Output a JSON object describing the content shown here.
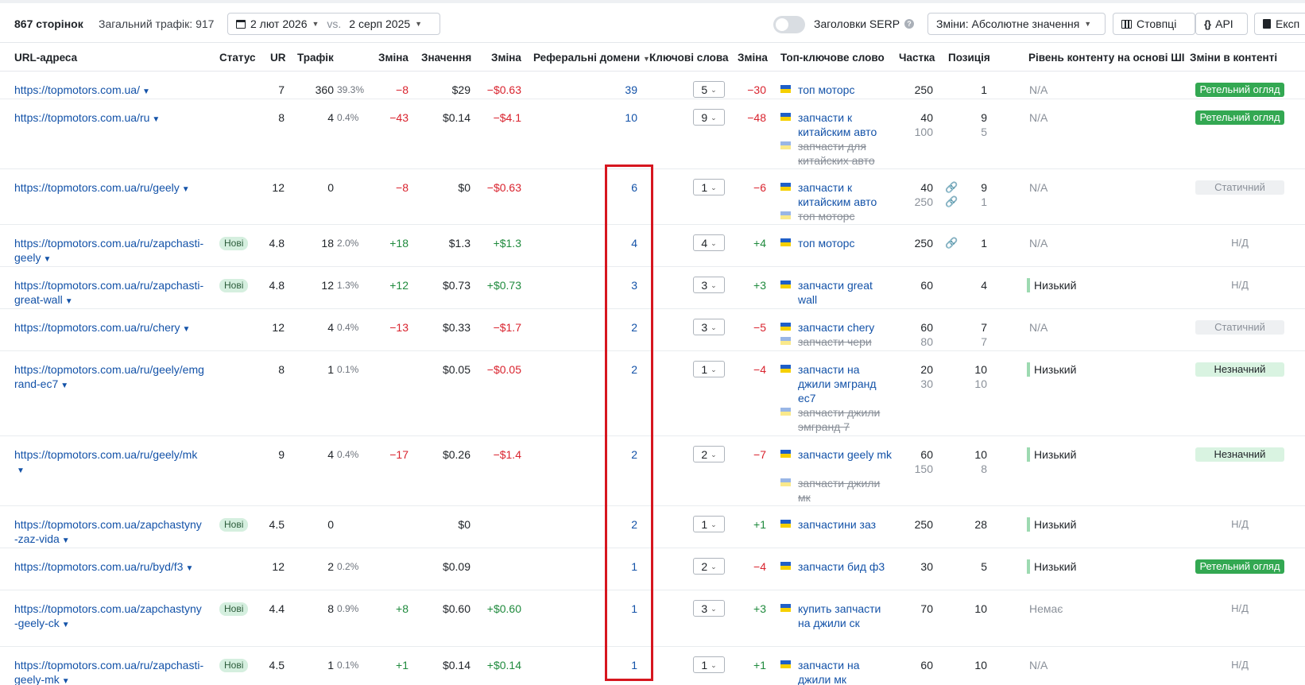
{
  "toolbar": {
    "pages_count": "867 сторінок",
    "total_traffic": "Загальний трафік: 917",
    "date_current": "2 лют 2026",
    "vs": "vs.",
    "date_compare": "2 серп 2025",
    "serp_titles": "Заголовки SERP",
    "changes_mode": "Зміни: Абсолютне значення",
    "columns": "Стовпці",
    "api": "API",
    "export": "Експ"
  },
  "columns": {
    "url": "URL-адреса",
    "status": "Статус",
    "ur": "UR",
    "traffic": "Трафік",
    "traffic_change": "Зміна",
    "value": "Значення",
    "value_change": "Зміна",
    "ref_domains": "Реферальні домени",
    "keywords": "Ключові слова",
    "kw_change": "Зміна",
    "top_keyword": "Топ-ключове слово",
    "share": "Частка",
    "position": "Позиція",
    "ai_content": "Рівень контенту на основі ШІ",
    "content_changes": "Зміни в контенті"
  },
  "rows": [
    {
      "url": "https://topmotors.com.ua/",
      "status": "",
      "ur": "7",
      "traffic": "360",
      "traffic_pct": "39.3%",
      "traffic_change": "−8",
      "value": "$29",
      "value_change": "−$0.63",
      "ref_domains": "39",
      "keywords": "5",
      "kw_change": "−30",
      "kw1": "топ моторс",
      "kw2": "",
      "share1": "250",
      "share2": "",
      "pos1": "1",
      "pos2": "",
      "ai": "N/A",
      "change": "Ретельний огляд"
    },
    {
      "url": "https://topmotors.com.ua/ru",
      "status": "",
      "ur": "8",
      "traffic": "4",
      "traffic_pct": "0.4%",
      "traffic_change": "−43",
      "value": "$0.14",
      "value_change": "−$4.1",
      "ref_domains": "10",
      "keywords": "9",
      "kw_change": "−48",
      "kw1": "запчасти к китайским авто",
      "kw2": "запчасти для китайских авто",
      "share1": "40",
      "share2": "100",
      "pos1": "9",
      "pos2": "5",
      "ai": "N/A",
      "change": "Ретельний огляд"
    },
    {
      "url": "https://topmotors.com.ua/ru/geely",
      "status": "",
      "ur": "12",
      "traffic": "0",
      "traffic_pct": "",
      "traffic_change": "−8",
      "value": "$0",
      "value_change": "−$0.63",
      "ref_domains": "6",
      "keywords": "1",
      "kw_change": "−6",
      "kw1": "запчасти к китайским авто",
      "kw2": "топ моторс",
      "share1": "40",
      "share2": "250",
      "pos1": "9",
      "pos2": "1",
      "ai": "N/A",
      "change": "Статичний"
    },
    {
      "url": "https://topmotors.com.ua/ru/zapchasti-geely",
      "status": "Нові",
      "ur": "4.8",
      "traffic": "18",
      "traffic_pct": "2.0%",
      "traffic_change": "+18",
      "value": "$1.3",
      "value_change": "+$1.3",
      "ref_domains": "4",
      "keywords": "4",
      "kw_change": "+4",
      "kw1": "топ моторс",
      "kw2": "",
      "share1": "250",
      "share2": "",
      "pos1": "1",
      "pos2": "",
      "ai": "N/A",
      "change": "Н/Д"
    },
    {
      "url": "https://topmotors.com.ua/ru/zapchasti-great-wall",
      "status": "Нові",
      "ur": "4.8",
      "traffic": "12",
      "traffic_pct": "1.3%",
      "traffic_change": "+12",
      "value": "$0.73",
      "value_change": "+$0.73",
      "ref_domains": "3",
      "keywords": "3",
      "kw_change": "+3",
      "kw1": "запчасти great wall",
      "kw2": "",
      "share1": "60",
      "share2": "",
      "pos1": "4",
      "pos2": "",
      "ai": "Низький",
      "change": "Н/Д"
    },
    {
      "url": "https://topmotors.com.ua/ru/chery",
      "status": "",
      "ur": "12",
      "traffic": "4",
      "traffic_pct": "0.4%",
      "traffic_change": "−13",
      "value": "$0.33",
      "value_change": "−$1.7",
      "ref_domains": "2",
      "keywords": "3",
      "kw_change": "−5",
      "kw1": "запчасти chery",
      "kw2": "запчасти чери",
      "share1": "60",
      "share2": "80",
      "pos1": "7",
      "pos2": "7",
      "ai": "N/A",
      "change": "Статичний"
    },
    {
      "url": "https://topmotors.com.ua/ru/geely/emgrand-ec7",
      "status": "",
      "ur": "8",
      "traffic": "1",
      "traffic_pct": "0.1%",
      "traffic_change": "",
      "value": "$0.05",
      "value_change": "−$0.05",
      "ref_domains": "2",
      "keywords": "1",
      "kw_change": "−4",
      "kw1": "запчасти на джили эмгранд ec7",
      "kw2": "запчасти джили эмгранд 7",
      "share1": "20",
      "share2": "30",
      "pos1": "10",
      "pos2": "10",
      "ai": "Низький",
      "change": "Незначний"
    },
    {
      "url": "https://topmotors.com.ua/ru/geely/mk",
      "status": "",
      "ur": "9",
      "traffic": "4",
      "traffic_pct": "0.4%",
      "traffic_change": "−17",
      "value": "$0.26",
      "value_change": "−$1.4",
      "ref_domains": "2",
      "keywords": "2",
      "kw_change": "−7",
      "kw1": "запчасти geely mk",
      "kw2": "запчасти джили мк",
      "share1": "60",
      "share2": "150",
      "pos1": "10",
      "pos2": "8",
      "ai": "Низький",
      "change": "Незначний"
    },
    {
      "url": "https://topmotors.com.ua/zapchastyny-zaz-vida",
      "status": "Нові",
      "ur": "4.5",
      "traffic": "0",
      "traffic_pct": "",
      "traffic_change": "",
      "value": "$0",
      "value_change": "",
      "ref_domains": "2",
      "keywords": "1",
      "kw_change": "+1",
      "kw1": "запчастини заз",
      "kw2": "",
      "share1": "250",
      "share2": "",
      "pos1": "28",
      "pos2": "",
      "ai": "Низький",
      "change": "Н/Д"
    },
    {
      "url": "https://topmotors.com.ua/ru/byd/f3",
      "status": "",
      "ur": "12",
      "traffic": "2",
      "traffic_pct": "0.2%",
      "traffic_change": "",
      "value": "$0.09",
      "value_change": "",
      "ref_domains": "1",
      "keywords": "2",
      "kw_change": "−4",
      "kw1": "запчасти бид ф3",
      "kw2": "",
      "share1": "30",
      "share2": "",
      "pos1": "5",
      "pos2": "",
      "ai": "Низький",
      "change": "Ретельний огляд"
    },
    {
      "url": "https://topmotors.com.ua/zapchastyny-geely-ck",
      "status": "Нові",
      "ur": "4.4",
      "traffic": "8",
      "traffic_pct": "0.9%",
      "traffic_change": "+8",
      "value": "$0.60",
      "value_change": "+$0.60",
      "ref_domains": "1",
      "keywords": "3",
      "kw_change": "+3",
      "kw1": "купить запчасти на джили ск",
      "kw2": "",
      "share1": "70",
      "share2": "",
      "pos1": "10",
      "pos2": "",
      "ai": "Немає",
      "change": "Н/Д"
    },
    {
      "url": "https://topmotors.com.ua/ru/zapchasti-geely-mk",
      "status": "Нові",
      "ur": "4.5",
      "traffic": "1",
      "traffic_pct": "0.1%",
      "traffic_change": "+1",
      "value": "$0.14",
      "value_change": "+$0.14",
      "ref_domains": "1",
      "keywords": "1",
      "kw_change": "+1",
      "kw1": "запчасти на джили мк",
      "kw2": "",
      "share1": "60",
      "share2": "",
      "pos1": "10",
      "pos2": "",
      "ai": "N/A",
      "change": "Н/Д"
    }
  ],
  "colors": {
    "negative": "#d9232e",
    "positive": "#1f8a3d",
    "link": "#1352a8",
    "highlight": "#d6161f",
    "review_badge": "#33a852"
  }
}
